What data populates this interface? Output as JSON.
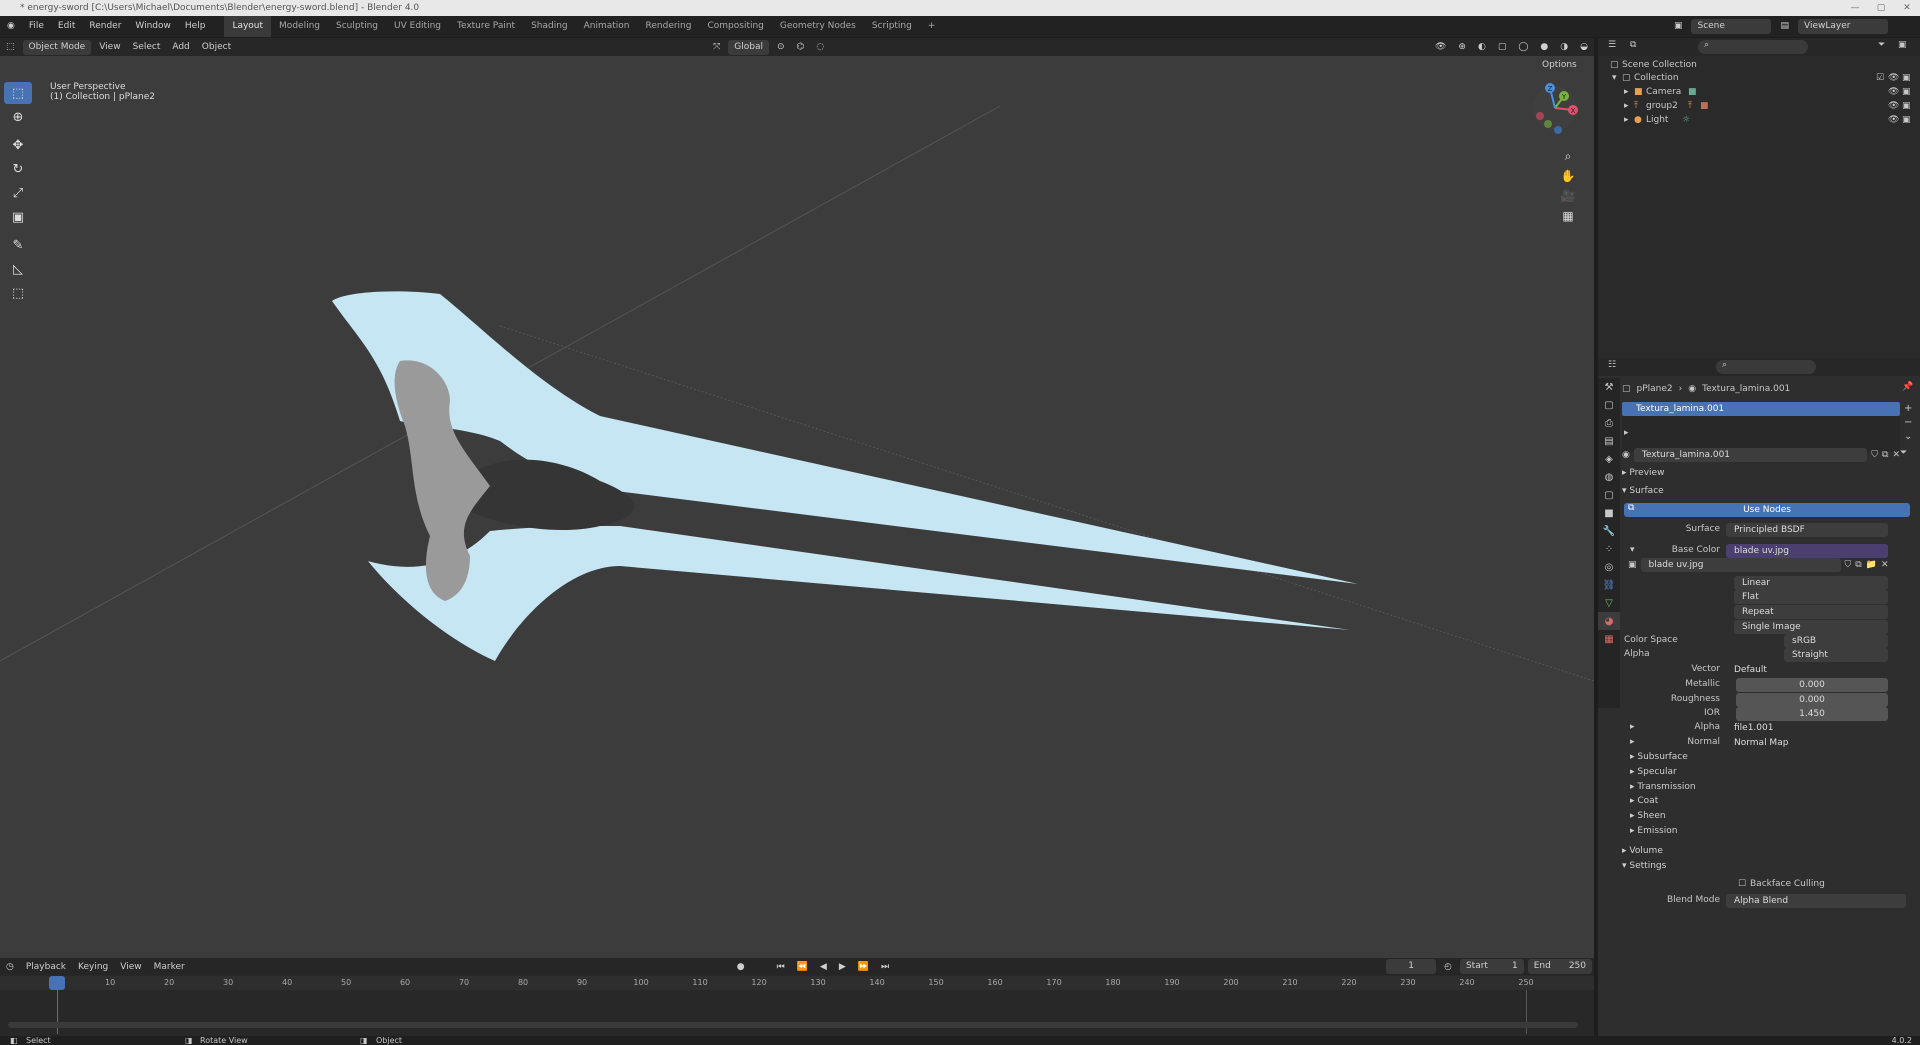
{
  "window": {
    "title": "* energy-sword [C:\\Users\\Michael\\Documents\\Blender\\energy-sword.blend] - Blender 4.0",
    "controls": [
      "—",
      "▢",
      "✕"
    ]
  },
  "menubar": {
    "menus": [
      "File",
      "Edit",
      "Render",
      "Window",
      "Help"
    ],
    "workspaces": [
      "Layout",
      "Modeling",
      "Sculpting",
      "UV Editing",
      "Texture Paint",
      "Shading",
      "Animation",
      "Rendering",
      "Compositing",
      "Geometry Nodes",
      "Scripting"
    ],
    "active_workspace": "Layout",
    "add_tab": "+",
    "scene": "Scene",
    "view_layer": "ViewLayer"
  },
  "viewport_header": {
    "mode": "Object Mode",
    "menus": [
      "View",
      "Select",
      "Add",
      "Object"
    ],
    "orientation": "Global",
    "options": "Options"
  },
  "viewport": {
    "info_line1": "User Perspective",
    "info_line2": "(1) Collection | pPlane2",
    "blade_color": "#c6e6f3",
    "background": "#3c3c3c"
  },
  "gizmo_axes": {
    "x": "X",
    "y": "Y",
    "z": "Z"
  },
  "timeline": {
    "menus": [
      "Playback",
      "Keying",
      "View",
      "Marker"
    ],
    "current_frame": "1",
    "start_label": "Start",
    "start": "1",
    "end_label": "End",
    "end": "250",
    "ticks": [
      "1",
      "10",
      "20",
      "30",
      "40",
      "50",
      "60",
      "70",
      "80",
      "90",
      "100",
      "110",
      "120",
      "130",
      "140",
      "150",
      "160",
      "170",
      "180",
      "190",
      "200",
      "210",
      "220",
      "230",
      "240",
      "250"
    ]
  },
  "statusbar": {
    "select": "Select",
    "rotate": "Rotate View",
    "object": "Object",
    "version": "4.0.2"
  },
  "outliner": {
    "root": "Scene Collection",
    "collection": "Collection",
    "items": [
      {
        "name": "Camera"
      },
      {
        "name": "group2"
      },
      {
        "name": "Light"
      }
    ]
  },
  "properties": {
    "breadcrumb_object": "pPlane2",
    "breadcrumb_material": "Textura_lamina.001",
    "material_slot": "Textura_lamina.001",
    "material_name": "Textura_lamina.001",
    "panels": {
      "preview": "Preview",
      "surface": "Surface",
      "volume": "Volume",
      "settings": "Settings"
    },
    "use_nodes": "Use Nodes",
    "surface_label": "Surface",
    "surface_value": "Principled BSDF",
    "base_color_label": "Base Color",
    "base_color_value": "blade uv.jpg",
    "image_name": "blade uv.jpg",
    "interp": "Linear",
    "projection": "Flat",
    "extension": "Repeat",
    "source": "Single Image",
    "color_space_label": "Color Space",
    "color_space": "sRGB",
    "alpha_mode_label": "Alpha",
    "alpha_mode": "Straight",
    "vector_label": "Vector",
    "vector_value": "Default",
    "metallic_label": "Metallic",
    "metallic": "0.000",
    "roughness_label": "Roughness",
    "roughness": "0.000",
    "ior_label": "IOR",
    "ior": "1.450",
    "alpha_label": "Alpha",
    "alpha_value": "file1.001",
    "normal_label": "Normal",
    "normal_value": "Normal Map",
    "subpanels": [
      "Subsurface",
      "Specular",
      "Transmission",
      "Coat",
      "Sheen",
      "Emission"
    ],
    "backface_culling": "Backface Culling",
    "blend_mode_label": "Blend Mode",
    "blend_mode": "Alpha Blend"
  }
}
